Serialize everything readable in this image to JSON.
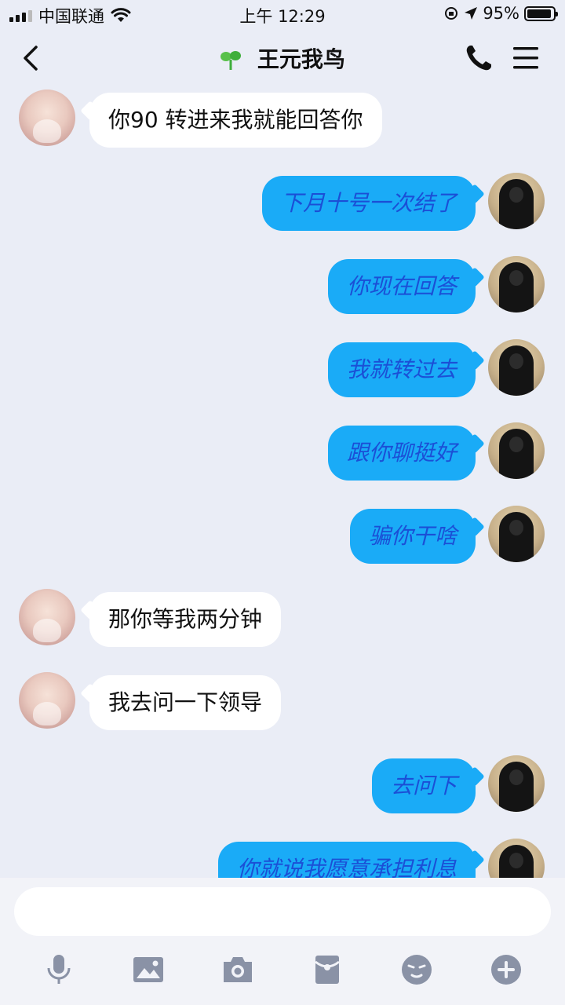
{
  "status_bar": {
    "carrier": "中国联通",
    "time": "上午 12:29",
    "battery": "95%",
    "battery_level": 0.95
  },
  "header": {
    "title": "王元我鸟"
  },
  "messages": [
    {
      "side": "in",
      "text": "你90 转进来我就能回答你"
    },
    {
      "side": "out",
      "text": "下月十号一次结了"
    },
    {
      "side": "out",
      "text": "你现在回答"
    },
    {
      "side": "out",
      "text": "我就转过去"
    },
    {
      "side": "out",
      "text": "跟你聊挺好"
    },
    {
      "side": "out",
      "text": "骗你干啥"
    },
    {
      "side": "in",
      "text": "那你等我两分钟"
    },
    {
      "side": "in",
      "text": "我去问一下领导"
    },
    {
      "side": "out",
      "text": "去问下"
    },
    {
      "side": "out",
      "text": "你就说我愿意承担利息"
    }
  ],
  "input": {
    "value": "",
    "placeholder": ""
  },
  "toolbar": {
    "icons": [
      "microphone-icon",
      "image-icon",
      "camera-icon",
      "red-packet-icon",
      "emoji-icon",
      "plus-icon"
    ]
  },
  "colors": {
    "background": "#eaedf6",
    "outgoing_bubble": "#1aabf7",
    "outgoing_text": "#1b4fd6",
    "incoming_bubble": "#ffffff"
  }
}
